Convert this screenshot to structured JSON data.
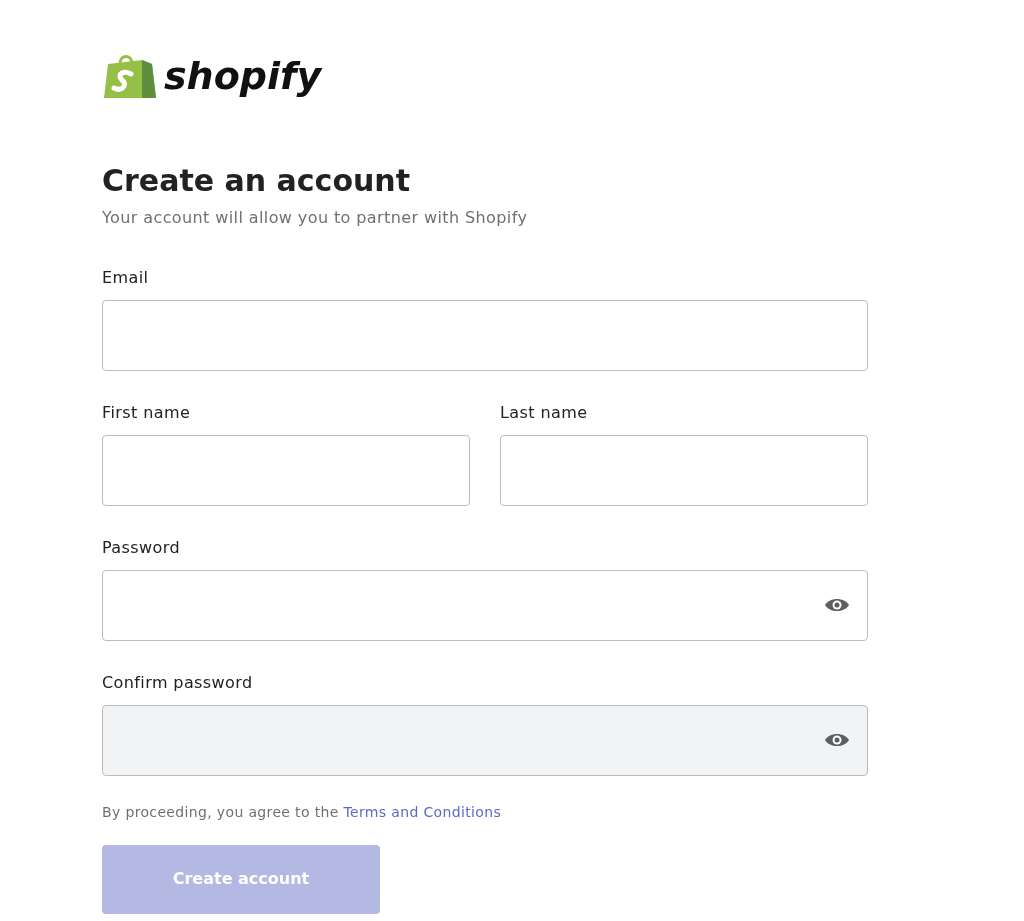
{
  "logo": {
    "wordmark": "shopify"
  },
  "heading": {
    "title": "Create an account",
    "subtitle": "Your account will allow you to partner with Shopify"
  },
  "form": {
    "rows": [
      {
        "fields": [
          {
            "label": "Email",
            "kind": "text",
            "disabled": false
          }
        ]
      },
      {
        "fields": [
          {
            "label": "First name",
            "kind": "text",
            "disabled": false
          },
          {
            "label": "Last name",
            "kind": "text",
            "disabled": false
          }
        ]
      },
      {
        "fields": [
          {
            "label": "Password",
            "kind": "password",
            "disabled": false
          }
        ]
      },
      {
        "fields": [
          {
            "label": "Confirm password",
            "kind": "password",
            "disabled": true
          }
        ]
      }
    ],
    "consent": {
      "text": "By proceeding, you agree to the",
      "link": "Terms and Conditions"
    },
    "submit": {
      "label": "Create account",
      "disabled": true
    }
  }
}
